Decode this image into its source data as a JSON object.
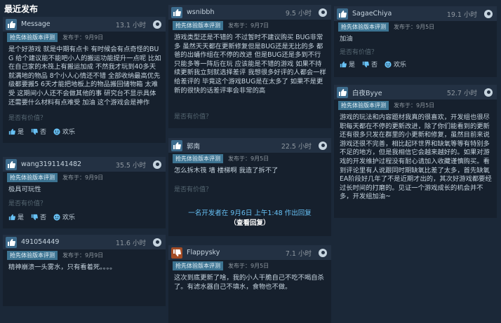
{
  "page": {
    "section_title": "最近发布"
  },
  "labels": {
    "early_access": "抢先体验版本评测",
    "helpful_question": "是否有价值？",
    "yes": "是",
    "no": "否",
    "funny": "欢乐"
  },
  "reviews": [
    {
      "username": "Message",
      "hours": "13.1 小时",
      "recommended": true,
      "posted": "发布于：9月9日",
      "text": "是个好游戏 就是中期有点卡 有时候会有点奇怪的BUG 给个建议能不能吧小人的搬运功能提升一点呢 比如在自己家的木筏上有搬运加成 不然我才玩到40多天就满地的物品 8个小人心情还不错 全部收纳最高优先级都要搬5 6天才能把地板上的物品搬回储物箱 太难受 这期间小人还不会做其他的事 研究台不显示具体还需要什么材料有点难受 加油 这个游戏会是神作"
    },
    {
      "username": "wang3191141482",
      "hours": "35.5 小时",
      "recommended": true,
      "posted": "发布于：9月9日",
      "text": "极具可玩性"
    },
    {
      "username": "491054449",
      "hours": "11.6 小时",
      "recommended": true,
      "posted": "发布于：9月9日",
      "text": "精神崩溃一头雾水，只有看着死。。。。"
    },
    {
      "username": "wsnibbh",
      "hours": "9.5 小时",
      "recommended": true,
      "posted": "发布于：9月7日",
      "text": "游戏类型还是不错的 不过暂时不建议购买 BUG非常多 虽然天天都在更新修复但是BUG还是无比的多 都爸的出蛹作组在不停的改进 但是BUG还是多到不行 只能多等一阵后在玩 应该能是不错的游戏 如果不持续更新我立刻就选择差评 我想很多好评的人都会一样给差评的 毕竟这个游戏BUG是在太多了 如果不是更新的很快的话差评率会非常的高"
    },
    {
      "username": "郭南",
      "hours": "22.5 小时",
      "recommended": true,
      "posted": "发布于：9月5日",
      "text": "怎么拆木筏 墙 楼梯啊 我造了拆不了",
      "dev_reply": "一名开发者在 9月6日 上午1:48 作出回复",
      "view_reply": "（查看回复）"
    },
    {
      "username": "Flappysky",
      "hours": "7.1 小时",
      "recommended": false,
      "posted": "发布于：9月5日",
      "text": "这次到底更新了啥，我的小人干脆自己不吃不喝自杀了。有滤水器自己不填水，食物也不做。"
    },
    {
      "username": "SagaeChiya",
      "hours": "19.1 小时",
      "recommended": true,
      "posted": "发布于：9月5日",
      "text": "加油"
    },
    {
      "username": "白夜Byye",
      "hours": "52.7 小时",
      "recommended": true,
      "posted": "发布于：9月5日",
      "text": "游戏的玩法和内容题材我真的很喜欢，开发组也很尽职每天都在不停的更新改进，除了你们能看到的更新还有很多只发在群里的小更新和修复，虽然目前来说游戏还很不完善，相比起环世界和缺氧等等有特别多不足的地方，但是我相信它会越来越好的。如果对游戏的开发维护过程没有耐心请加入收藏谨慎购买。看到评论里有人说跟同时期缺氧比差了太多，首先缺氧EA阶段好几年了不是近期才出的，其次好游戏都要经过长时间的打磨的。见证一个游戏成长的机会并不多，开发组加油~"
    }
  ]
}
